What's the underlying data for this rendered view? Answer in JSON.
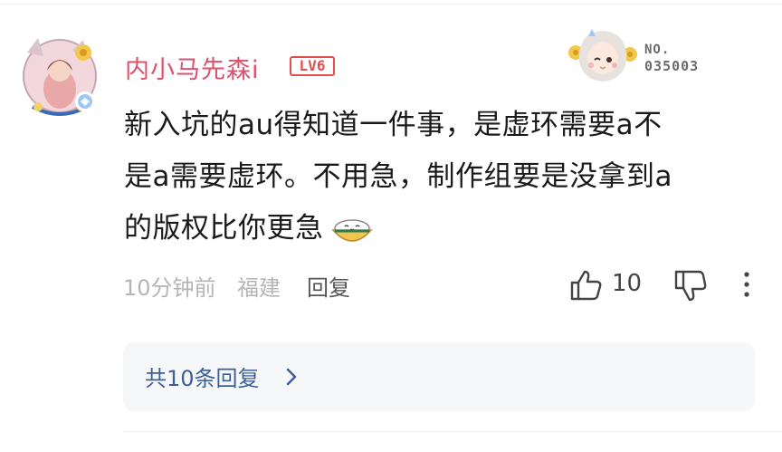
{
  "comment": {
    "username": "内小马先森i",
    "level_badge": "LV6",
    "fan_card": {
      "label": "NO.",
      "number": "035003"
    },
    "text_lines": [
      "新入坑的au得知道一件事，是虚环需要a不",
      "是a需要虚环。不用急，制作组要是没拿到a",
      "的版权比你更急"
    ],
    "emoji": "rice-bowl-emoji",
    "time": "10分钟前",
    "location": "福建",
    "reply_label": "回复",
    "like_count": "10",
    "replies_summary": "共10条回复"
  },
  "colors": {
    "username": "#d9536f",
    "level_badge": "#e24d4d",
    "replies_link": "#3d5f99",
    "meta": "#b5b5b5"
  },
  "icons": [
    "avatar",
    "fan-card-image",
    "rice-bowl-emoji",
    "thumbs-up-icon",
    "thumbs-down-icon",
    "more-vertical-icon",
    "chevron-right-icon"
  ]
}
